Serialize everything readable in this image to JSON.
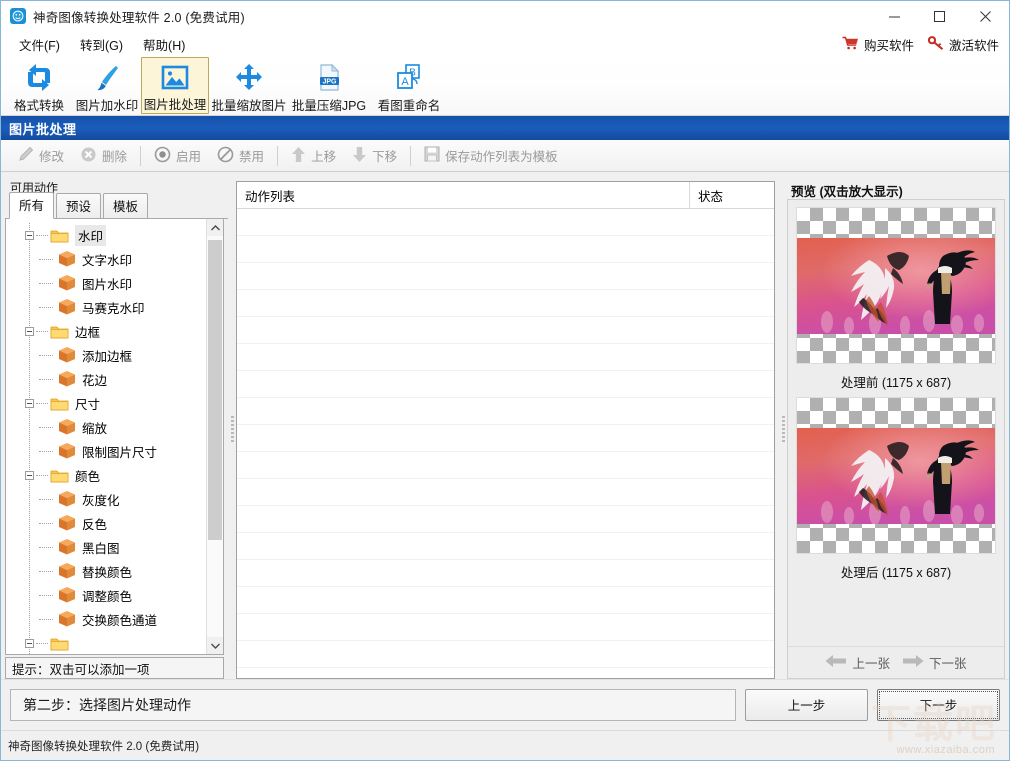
{
  "window": {
    "title": "神奇图像转换处理软件 2.0 (免费试用)",
    "app_icon": "app-icon",
    "minimize_label": "—",
    "maximize_label": "□",
    "close_label": "✕"
  },
  "menubar": {
    "items": [
      {
        "label": "文件(F)",
        "name": "menu-file"
      },
      {
        "label": "转到(G)",
        "name": "menu-goto"
      },
      {
        "label": "帮助(H)",
        "name": "menu-help"
      }
    ],
    "right_items": [
      {
        "label": "购买软件",
        "icon": "cart-icon",
        "name": "buy-software"
      },
      {
        "label": "激活软件",
        "icon": "key-icon",
        "name": "activate-software"
      }
    ]
  },
  "toolbar": {
    "items": [
      {
        "label": "格式转换",
        "icon": "convert-icon",
        "selected": false
      },
      {
        "label": "图片加水印",
        "icon": "brush-icon",
        "selected": false
      },
      {
        "label": "图片批处理",
        "icon": "image-batch-icon",
        "selected": true
      },
      {
        "label": "批量缩放图片",
        "icon": "move-arrows-icon",
        "selected": false
      },
      {
        "label": "批量压缩JPG",
        "icon": "jpg-file-icon",
        "selected": false
      },
      {
        "label": "看图重命名",
        "icon": "rename-icon",
        "selected": false
      }
    ]
  },
  "section": {
    "title": "图片批处理"
  },
  "action_toolbar": {
    "buttons": [
      {
        "label": "修改",
        "icon": "pencil-icon",
        "enabled": false
      },
      {
        "label": "删除",
        "icon": "delete-icon",
        "enabled": false
      },
      {
        "label": "启用",
        "icon": "enable-icon",
        "enabled": false
      },
      {
        "label": "禁用",
        "icon": "disable-icon",
        "enabled": false
      },
      {
        "label": "上移",
        "icon": "arrow-up-icon",
        "enabled": false
      },
      {
        "label": "下移",
        "icon": "arrow-down-icon",
        "enabled": false
      },
      {
        "label": "保存动作列表为模板",
        "icon": "save-icon",
        "enabled": false
      }
    ]
  },
  "left_panel": {
    "title": "可用动作",
    "tabs": [
      {
        "label": "所有",
        "active": true
      },
      {
        "label": "预设",
        "active": false
      },
      {
        "label": "模板",
        "active": false
      }
    ],
    "tree": [
      {
        "label": "水印",
        "type": "folder",
        "selected": true
      },
      {
        "label": "文字水印",
        "type": "item"
      },
      {
        "label": "图片水印",
        "type": "item"
      },
      {
        "label": "马赛克水印",
        "type": "item"
      },
      {
        "label": "边框",
        "type": "folder"
      },
      {
        "label": "添加边框",
        "type": "item"
      },
      {
        "label": "花边",
        "type": "item"
      },
      {
        "label": "尺寸",
        "type": "folder"
      },
      {
        "label": "缩放",
        "type": "item"
      },
      {
        "label": "限制图片尺寸",
        "type": "item"
      },
      {
        "label": "颜色",
        "type": "folder"
      },
      {
        "label": "灰度化",
        "type": "item"
      },
      {
        "label": "反色",
        "type": "item"
      },
      {
        "label": "黑白图",
        "type": "item"
      },
      {
        "label": "替换颜色",
        "type": "item"
      },
      {
        "label": "调整颜色",
        "type": "item"
      },
      {
        "label": "交换颜色通道",
        "type": "item"
      }
    ],
    "tip": "提示：双击可以添加一项"
  },
  "center_panel": {
    "columns": [
      {
        "label": "动作列表",
        "name": "column-action-list"
      },
      {
        "label": "状态",
        "name": "column-status"
      }
    ],
    "rows": []
  },
  "preview": {
    "title": "预览 (双击放大显示)",
    "before_caption": "处理前 (1175 x 687)",
    "after_caption": "处理后 (1175 x 687)",
    "prev_label": "上一张",
    "next_label": "下一张"
  },
  "footer": {
    "step_text": "第二步：选择图片处理动作",
    "prev_button": "上一步",
    "next_button": "下一步"
  },
  "statusbar": {
    "text": "神奇图像转换处理软件 2.0 (免费试用)"
  },
  "watermark": {
    "url": "www.xiazaiba.com"
  },
  "colors": {
    "accent_blue": "#1b5dbd",
    "toolbar_icon_blue": "#1b8ae0",
    "selected_tool_bg": "#fdf5d8",
    "red_link": "#c42b21"
  }
}
